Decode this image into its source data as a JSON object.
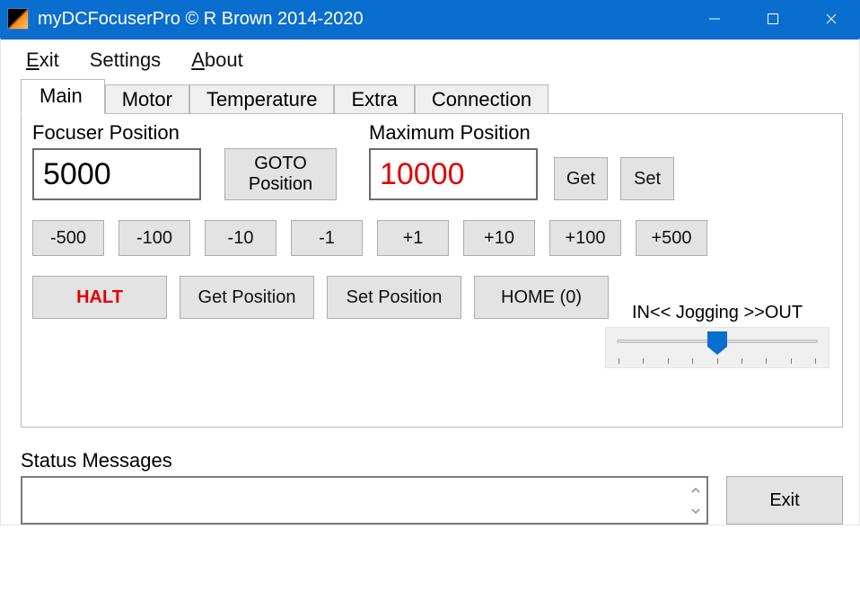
{
  "window": {
    "title": "myDCFocuserPro © R Brown 2014-2020"
  },
  "menu": {
    "exit_first": "E",
    "exit_rest": "xit",
    "settings": "Settings",
    "about_first": "A",
    "about_rest": "bout"
  },
  "tabs": {
    "main": "Main",
    "motor": "Motor",
    "temperature": "Temperature",
    "extra": "Extra",
    "connection": "Connection"
  },
  "main_tab": {
    "focuser_label": "Focuser Position",
    "focuser_value": "5000",
    "goto": "GOTO Position",
    "max_label": "Maximum Position",
    "max_value": "10000",
    "get": "Get",
    "set": "Set",
    "steps": {
      "m500": "-500",
      "m100": "-100",
      "m10": "-10",
      "m1": "-1",
      "p1": "+1",
      "p10": "+10",
      "p100": "+100",
      "p500": "+500"
    },
    "actions": {
      "halt": "HALT",
      "get_pos": "Get Position",
      "set_pos": "Set Position",
      "home": "HOME (0)"
    },
    "jog_label": "IN<< Jogging >>OUT"
  },
  "status": {
    "label": "Status Messages",
    "value": "",
    "exit": "Exit"
  }
}
